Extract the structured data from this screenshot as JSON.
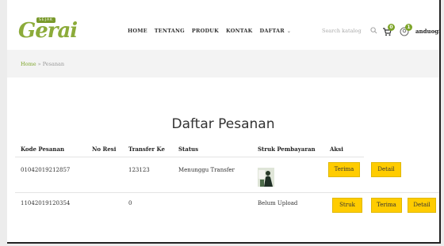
{
  "brand": {
    "badge": "SEJAK",
    "name": "Gerai"
  },
  "nav": [
    {
      "label": "HOME"
    },
    {
      "label": "TENTANG"
    },
    {
      "label": "PRODUK"
    },
    {
      "label": "KONTAK"
    },
    {
      "label": "DAFTAR",
      "has_dropdown": true
    }
  ],
  "search": {
    "placeholder": "Search katalog"
  },
  "cart": {
    "count": "0"
  },
  "notifications": {
    "count": "1"
  },
  "user": {
    "name": "anduogi"
  },
  "breadcrumb": {
    "home": "Home",
    "separator": " » ",
    "current": "Pesanan"
  },
  "page": {
    "title": "Daftar Pesanan"
  },
  "table": {
    "headers": [
      "Kode Pesanan",
      "No Resi",
      "Transfer Ke",
      "Status",
      "Struk Pembayaran",
      "Aksi"
    ],
    "rows": [
      {
        "kode": "01042019212857",
        "resi": "",
        "transfer": "123123",
        "status": "Menunggu Transfer",
        "struk": "",
        "actions": [
          "Terima",
          "Detail"
        ]
      },
      {
        "kode": "11042019120354",
        "resi": "",
        "transfer": "0",
        "status": "",
        "struk": "Belum Upload",
        "actions": [
          "Struk",
          "Terima",
          "Detail"
        ]
      }
    ]
  },
  "colors": {
    "accent": "#7ea52a",
    "button": "#ffcc00",
    "band": "#f3f3f3"
  }
}
